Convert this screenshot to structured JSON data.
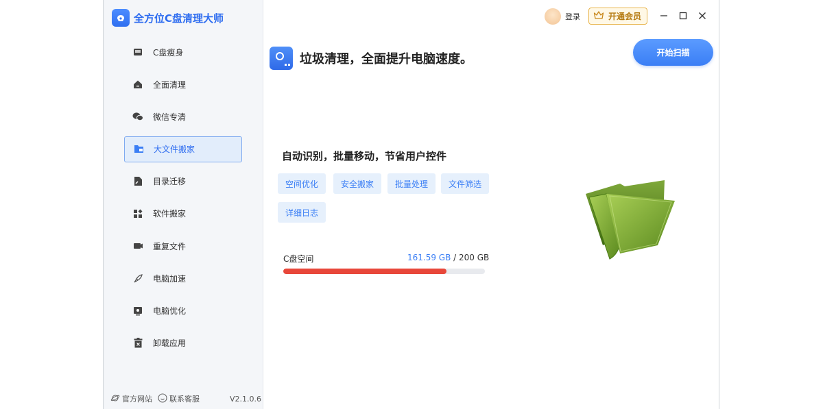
{
  "app": {
    "title": "全方位C盘清理大师",
    "version": "V2.1.0.6"
  },
  "sidebar": {
    "items": [
      {
        "label": "C盘瘦身",
        "icon": "disk-slim-icon"
      },
      {
        "label": "全面清理",
        "icon": "home-clean-icon"
      },
      {
        "label": "微信专清",
        "icon": "wechat-icon"
      },
      {
        "label": "大文件搬家",
        "icon": "folder-move-icon",
        "active": true
      },
      {
        "label": "目录迁移",
        "icon": "file-migrate-icon"
      },
      {
        "label": "软件搬家",
        "icon": "apps-move-icon"
      },
      {
        "label": "重复文件",
        "icon": "duplicate-file-icon"
      },
      {
        "label": "电脑加速",
        "icon": "rocket-icon"
      },
      {
        "label": "电脑优化",
        "icon": "optimize-icon"
      },
      {
        "label": "卸载应用",
        "icon": "uninstall-icon"
      }
    ],
    "footer": {
      "website": "官方网站",
      "support": "联系客服"
    }
  },
  "topbar": {
    "login": "登录",
    "vip": "开通会员"
  },
  "main": {
    "headline": "垃圾清理，全面提升电脑速度。",
    "scan_button": "开始扫描",
    "feature_title": "自动识别，批量移动，节省用户控件",
    "tags": [
      "空间优化",
      "安全搬家",
      "批量处理",
      "文件筛选",
      "详细日志"
    ],
    "disk": {
      "label": "C盘空间",
      "used": "161.59 GB",
      "separator": " / ",
      "total": "200 GB",
      "used_fraction": 0.808
    }
  },
  "colors": {
    "accent": "#3a7ef5",
    "bar_fill": "#e8473a",
    "vip_gold": "#e8b44a"
  }
}
